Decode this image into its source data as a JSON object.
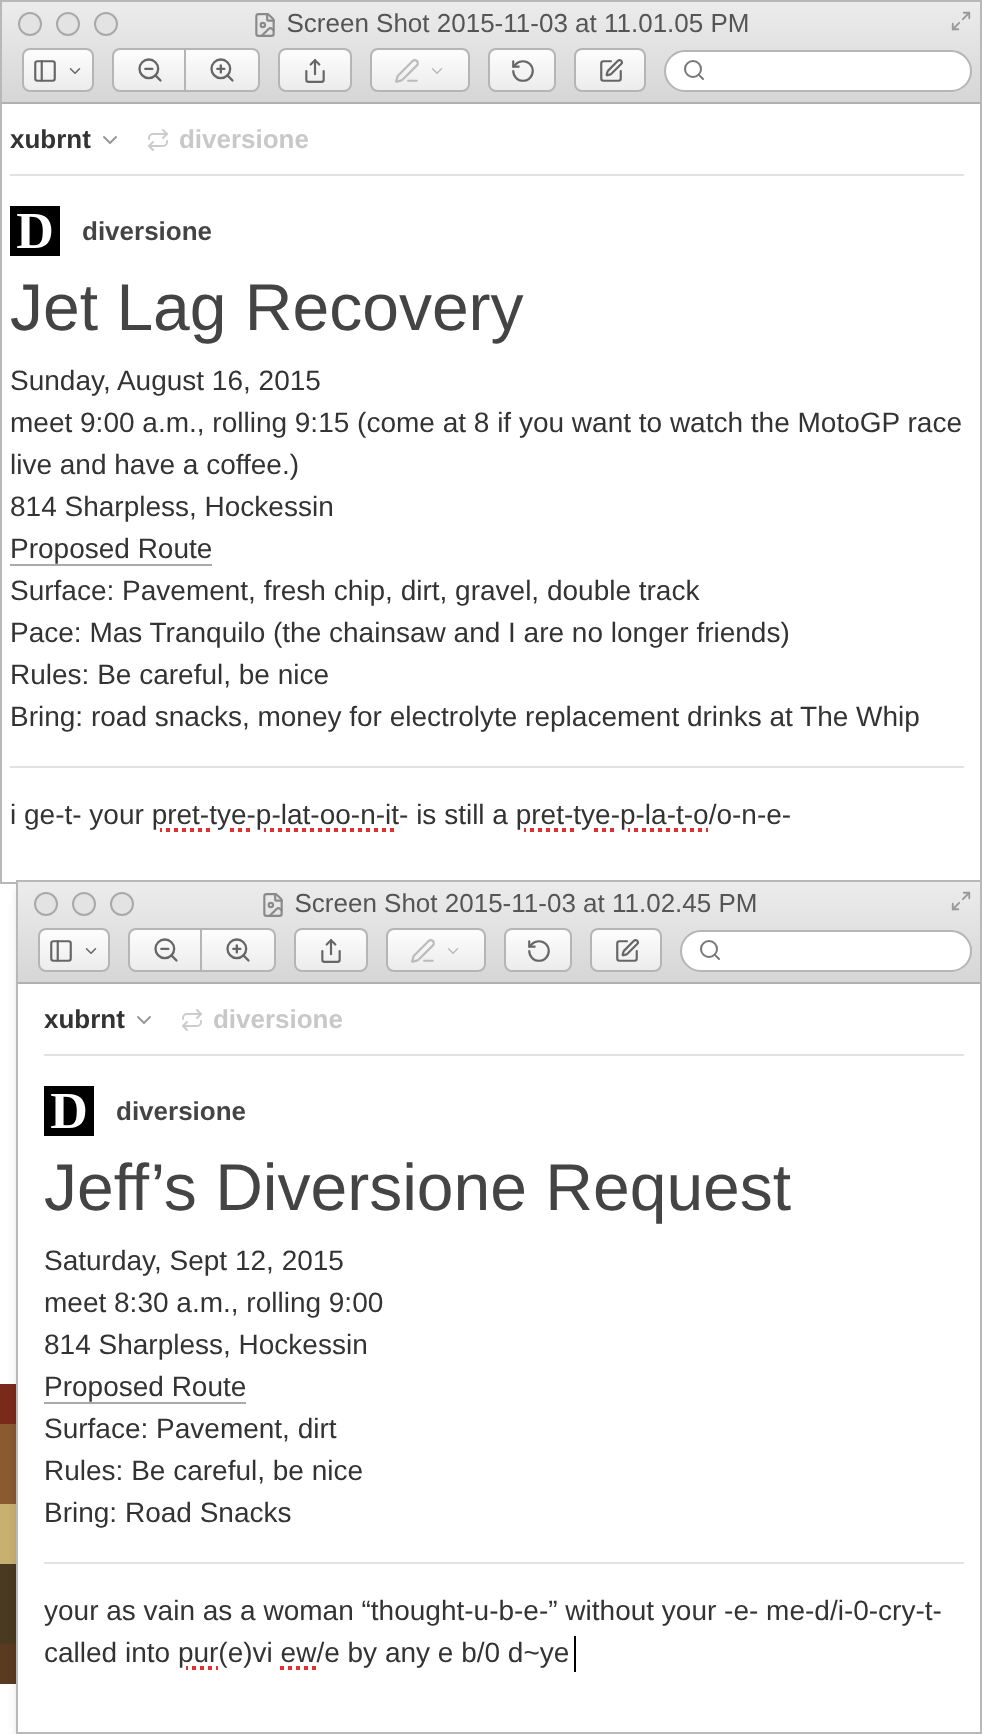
{
  "windows": [
    {
      "title": "Screen Shot 2015-11-03 at 11.01.05 PM",
      "account": "xubrnt",
      "reblog": "diversione",
      "blog": "diversione",
      "logo": "D",
      "post_title": "Jet Lag Recovery",
      "lines": [
        {
          "kind": "text",
          "text": "Sunday, August 16, 2015"
        },
        {
          "kind": "text",
          "text": "meet 9:00 a.m., rolling 9:15 (come at 8 if you want to watch the MotoGP race live and have a coffee.)"
        },
        {
          "kind": "text",
          "text": "814 Sharpless, Hockessin"
        },
        {
          "kind": "link",
          "text": "Proposed Route"
        },
        {
          "kind": "text",
          "text": "Surface: Pavement, fresh chip, dirt, gravel, double track"
        },
        {
          "kind": "text",
          "text": "Pace: Mas Tranquilo (the chainsaw and I are no longer friends)"
        },
        {
          "kind": "text",
          "text": "Rules: Be careful, be nice"
        },
        {
          "kind": "text",
          "text": "Bring: road snacks, money for electrolyte replacement drinks at The Whip"
        }
      ],
      "comment": {
        "cursor": false,
        "segments": [
          {
            "text": "i ge-t- your ",
            "misspelled": false
          },
          {
            "text": "pret-tye-p-lat-oo-n-it",
            "misspelled": true
          },
          {
            "text": "- is still a ",
            "misspelled": false
          },
          {
            "text": "pret-tye-p-la-t-o",
            "misspelled": true
          },
          {
            "text": "/o-n-e-",
            "misspelled": false
          }
        ]
      }
    },
    {
      "title": "Screen Shot 2015-11-03 at 11.02.45 PM",
      "account": "xubrnt",
      "reblog": "diversione",
      "blog": "diversione",
      "logo": "D",
      "post_title": "Jeff’s Diversione Request",
      "lines": [
        {
          "kind": "text",
          "text": "Saturday, Sept 12, 2015"
        },
        {
          "kind": "text",
          "text": "meet 8:30 a.m., rolling 9:00"
        },
        {
          "kind": "text",
          "text": "814 Sharpless, Hockessin"
        },
        {
          "kind": "link",
          "text": "Proposed Route"
        },
        {
          "kind": "text",
          "text": "Surface: Pavement, dirt"
        },
        {
          "kind": "text",
          "text": "Rules: Be careful, be nice"
        },
        {
          "kind": "text",
          "text": "Bring: Road Snacks"
        }
      ],
      "comment": {
        "cursor": true,
        "segments": [
          {
            "text": "your as vain as a woman “thought-u-b-e-” without your -e- me-d/i-0-cry-t- called into ",
            "misspelled": false
          },
          {
            "text": "pur",
            "misspelled": true
          },
          {
            "text": "(e)vi ",
            "misspelled": false
          },
          {
            "text": "ew",
            "misspelled": true
          },
          {
            "text": "/e by any e b/0 d~ye",
            "misspelled": false
          }
        ]
      }
    }
  ]
}
